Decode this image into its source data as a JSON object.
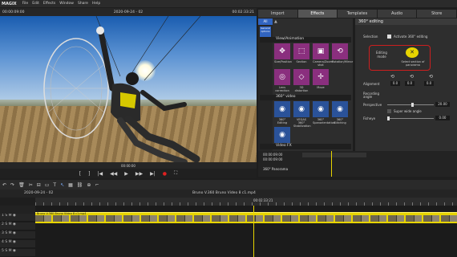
{
  "menubar": {
    "logo": "MAGIX",
    "items": [
      "File",
      "Edit",
      "Effects",
      "Window",
      "Share",
      "Help"
    ]
  },
  "preview": {
    "timecode_left": "00:00:09:00",
    "date_label": "2020-09-24 - 02",
    "timecode_right": "00:02:33:21",
    "footer_time": "00:00:00"
  },
  "tabs": [
    "Import",
    "Effects",
    "Templates",
    "Audio",
    "Store"
  ],
  "browser": {
    "all_label": "All",
    "general_label": "General options",
    "group1": "View/Animation",
    "group1_items": [
      "Size/Position",
      "Section",
      "Camera/Zoom shot",
      "Rotation/Mirror",
      "Lens correction",
      "3D distortion",
      "Move"
    ],
    "group2": "360° video",
    "group2_items": [
      "360° Editing",
      "VEGAS 360° Stabilization",
      "360° Spanorientation",
      "360° Stitching",
      "360° Stabilization"
    ],
    "group3": "Video FX"
  },
  "settings": {
    "title": "360° editing",
    "selection_label": "Selection",
    "activate_label": "Activate 360° editing",
    "editing_mode_label": "Editing mode",
    "select_section_label": "Select section of panorama",
    "alignment_label": "Alignment",
    "alignment_values": [
      "0.0",
      "0.0",
      "0.0"
    ],
    "recording_angle_label": "Recording angle",
    "perspective_label": "Perspective",
    "perspective_value": "20.00",
    "super_wide_label": "Super wide angle",
    "fisheye_label": "Fisheye",
    "fisheye_value": "0.00"
  },
  "minitimeline": {
    "time_start": "00:00:09:00",
    "time_end": "00:00:09:00",
    "effect_label": "360° Panorama"
  },
  "project": {
    "date_label": "2020-09-24 - 02",
    "clip_title": "Bruno V.360 Bruno Video 8 c1.mp4",
    "ruler_time": "00:02:33:21",
    "clip_label": "Bruno V.360 Bruno Video 8 c1.mp4"
  },
  "tracks": [
    "1",
    "2",
    "3",
    "4",
    "5",
    "6"
  ],
  "colors": {
    "accent": "#e7d400",
    "highlight": "#cc1e1e",
    "tile_purple": "#8a2f7e"
  }
}
